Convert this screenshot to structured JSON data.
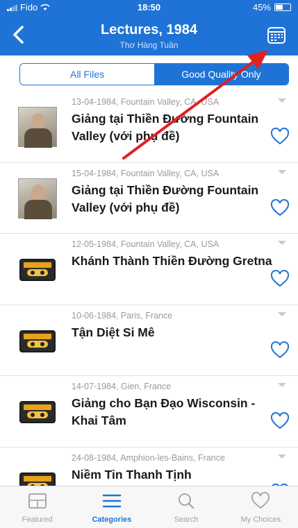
{
  "status_bar": {
    "carrier": "Fido",
    "time": "18:50",
    "battery": "45%",
    "battery_level": 0.45
  },
  "nav": {
    "title": "Lectures, 1984",
    "subtitle": "Thơ Hàng Tuần"
  },
  "segment": {
    "options": [
      "All Files",
      "Good Quality Only"
    ],
    "selected": "Good Quality Only"
  },
  "lectures": [
    {
      "meta": "13-04-1984, Fountain Valley, CA, USA",
      "title": "Giảng tại Thiền Đường Fountain Valley (với phụ đề)",
      "thumb": "photo"
    },
    {
      "meta": "15-04-1984, Fountain Valley, CA, USA",
      "title": "Giảng tại Thiền Đường Fountain Valley (với phụ đề)",
      "thumb": "photo"
    },
    {
      "meta": "12-05-1984, Fountain Valley, CA, USA",
      "title": "Khánh Thành Thiền Đường Gretna",
      "thumb": "cassette"
    },
    {
      "meta": "10-06-1984, Paris, France",
      "title": "Tận Diệt Si Mê",
      "thumb": "cassette"
    },
    {
      "meta": "14-07-1984, Gien, France",
      "title": "Giảng cho Bạn Đạo Wisconsin - Khai Tâm",
      "thumb": "cassette"
    },
    {
      "meta": "24-08-1984, Amphion-les-Bains, France",
      "title": "Niềm Tin Thanh Tịnh",
      "thumb": "cassette"
    }
  ],
  "tabs": [
    {
      "label": "Featured",
      "icon": "featured-icon"
    },
    {
      "label": "Categories",
      "icon": "categories-icon"
    },
    {
      "label": "Search",
      "icon": "search-icon"
    },
    {
      "label": "My Choices",
      "icon": "heart-icon"
    }
  ],
  "active_tab": "Categories",
  "colors": {
    "primary": "#1f73d6",
    "annotation": "#e02020",
    "inactive": "#a0a0a0"
  }
}
